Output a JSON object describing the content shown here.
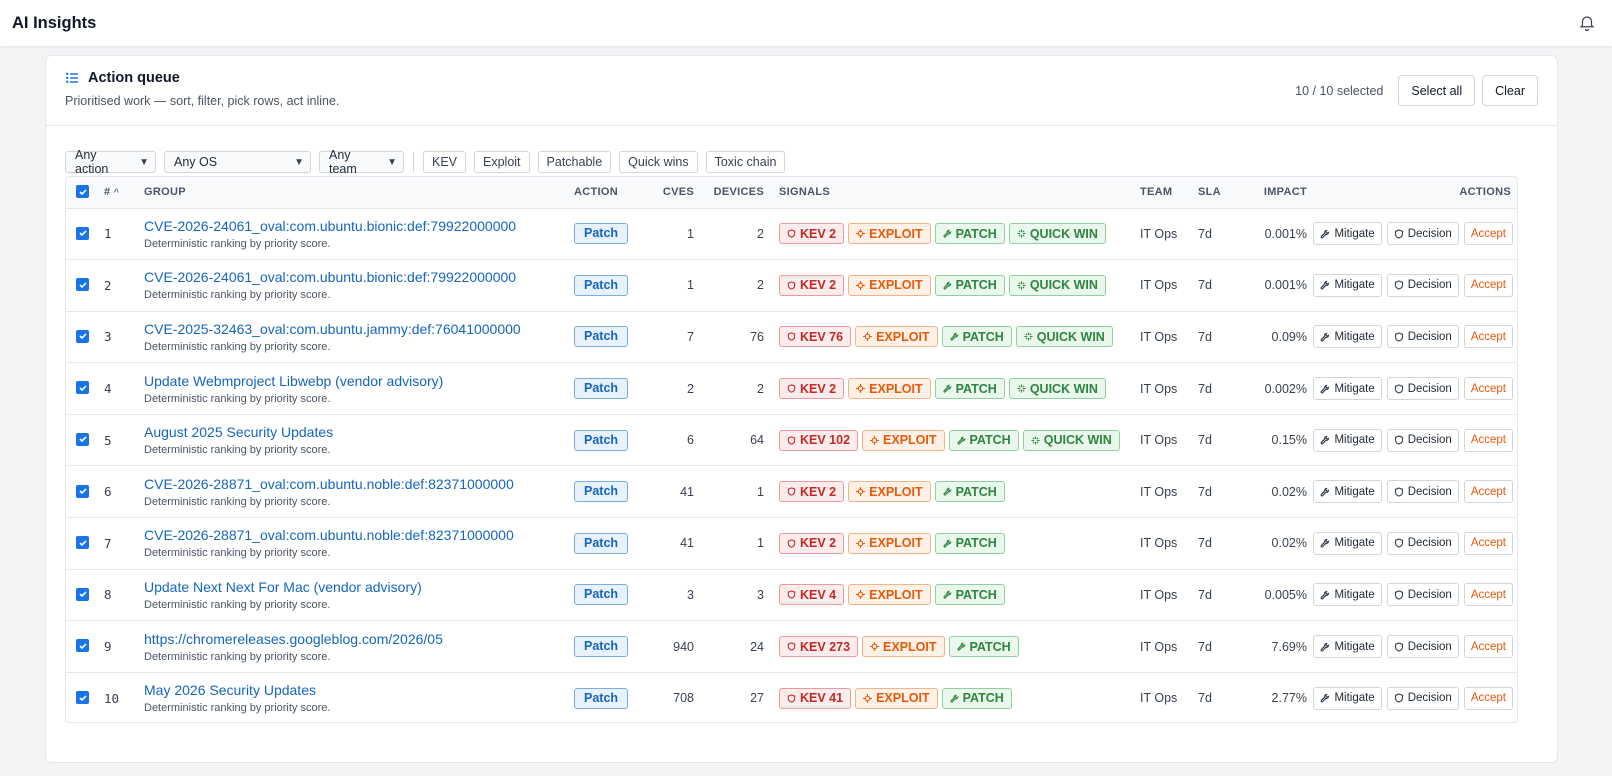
{
  "app": {
    "title": "AI Insights",
    "bell_icon": "bell-icon"
  },
  "queue": {
    "title": "Action queue",
    "subtitle": "Prioritised work — sort, filter, pick rows, act inline.",
    "selected_text": "10 / 10 selected",
    "select_all_label": "Select all",
    "clear_label": "Clear"
  },
  "filters": {
    "action": "Any action",
    "os": "Any OS",
    "team": "Any team",
    "chips": [
      "KEV",
      "Exploit",
      "Patchable",
      "Quick wins",
      "Toxic chain"
    ]
  },
  "table": {
    "headers": {
      "num": "#",
      "group": "GROUP",
      "action": "ACTION",
      "cves": "CVES",
      "devices": "DEVICES",
      "signals": "SIGNALS",
      "team": "TEAM",
      "sla": "SLA",
      "impact": "IMPACT",
      "actions": "ACTIONS"
    },
    "row_buttons": {
      "mitigate": "Mitigate",
      "decision": "Decision",
      "accept": "Accept"
    },
    "rows": [
      {
        "num": "1",
        "group": "CVE-2026-24061_oval:com.ubuntu.bionic:def:79922000000",
        "desc": "Deterministic ranking by priority score.",
        "action": "Patch",
        "cves": "1",
        "devices": "2",
        "kev": "KEV 2",
        "exploit": "EXPLOIT",
        "patch": "PATCH",
        "quick": "QUICK WIN",
        "team": "IT Ops",
        "sla": "7d",
        "impact": "0.001%"
      },
      {
        "num": "2",
        "group": "CVE-2026-24061_oval:com.ubuntu.bionic:def:79922000000",
        "desc": "Deterministic ranking by priority score.",
        "action": "Patch",
        "cves": "1",
        "devices": "2",
        "kev": "KEV 2",
        "exploit": "EXPLOIT",
        "patch": "PATCH",
        "quick": "QUICK WIN",
        "team": "IT Ops",
        "sla": "7d",
        "impact": "0.001%"
      },
      {
        "num": "3",
        "group": "CVE-2025-32463_oval:com.ubuntu.jammy:def:76041000000",
        "desc": "Deterministic ranking by priority score.",
        "action": "Patch",
        "cves": "7",
        "devices": "76",
        "kev": "KEV 76",
        "exploit": "EXPLOIT",
        "patch": "PATCH",
        "quick": "QUICK WIN",
        "team": "IT Ops",
        "sla": "7d",
        "impact": "0.09%"
      },
      {
        "num": "4",
        "group": "Update Webmproject Libwebp (vendor advisory)",
        "desc": "Deterministic ranking by priority score.",
        "action": "Patch",
        "cves": "2",
        "devices": "2",
        "kev": "KEV 2",
        "exploit": "EXPLOIT",
        "patch": "PATCH",
        "quick": "QUICK WIN",
        "team": "IT Ops",
        "sla": "7d",
        "impact": "0.002%"
      },
      {
        "num": "5",
        "group": "August 2025 Security Updates",
        "desc": "Deterministic ranking by priority score.",
        "action": "Patch",
        "cves": "6",
        "devices": "64",
        "kev": "KEV 102",
        "exploit": "EXPLOIT",
        "patch": "PATCH",
        "quick": "QUICK WIN",
        "team": "IT Ops",
        "sla": "7d",
        "impact": "0.15%"
      },
      {
        "num": "6",
        "group": "CVE-2026-28871_oval:com.ubuntu.noble:def:82371000000",
        "desc": "Deterministic ranking by priority score.",
        "action": "Patch",
        "cves": "41",
        "devices": "1",
        "kev": "KEV 2",
        "exploit": "EXPLOIT",
        "patch": "PATCH",
        "quick": "",
        "team": "IT Ops",
        "sla": "7d",
        "impact": "0.02%"
      },
      {
        "num": "7",
        "group": "CVE-2026-28871_oval:com.ubuntu.noble:def:82371000000",
        "desc": "Deterministic ranking by priority score.",
        "action": "Patch",
        "cves": "41",
        "devices": "1",
        "kev": "KEV 2",
        "exploit": "EXPLOIT",
        "patch": "PATCH",
        "quick": "",
        "team": "IT Ops",
        "sla": "7d",
        "impact": "0.02%"
      },
      {
        "num": "8",
        "group": "Update Next Next For Mac (vendor advisory)",
        "desc": "Deterministic ranking by priority score.",
        "action": "Patch",
        "cves": "3",
        "devices": "3",
        "kev": "KEV 4",
        "exploit": "EXPLOIT",
        "patch": "PATCH",
        "quick": "",
        "team": "IT Ops",
        "sla": "7d",
        "impact": "0.005%"
      },
      {
        "num": "9",
        "group": "https://chromereleases.googleblog.com/2026/05",
        "desc": "Deterministic ranking by priority score.",
        "action": "Patch",
        "cves": "940",
        "devices": "24",
        "kev": "KEV 273",
        "exploit": "EXPLOIT",
        "patch": "PATCH",
        "quick": "",
        "team": "IT Ops",
        "sla": "7d",
        "impact": "7.69%"
      },
      {
        "num": "10",
        "group": "May 2026 Security Updates",
        "desc": "Deterministic ranking by priority score.",
        "action": "Patch",
        "cves": "708",
        "devices": "27",
        "kev": "KEV 41",
        "exploit": "EXPLOIT",
        "patch": "PATCH",
        "quick": "",
        "team": "IT Ops",
        "sla": "7d",
        "impact": "2.77%"
      }
    ]
  },
  "colors": {
    "link": "#1565c0",
    "checkbox": "#1a73e8",
    "kev": "#c62828",
    "exploit": "#e8590c",
    "patch": "#2e8540"
  }
}
